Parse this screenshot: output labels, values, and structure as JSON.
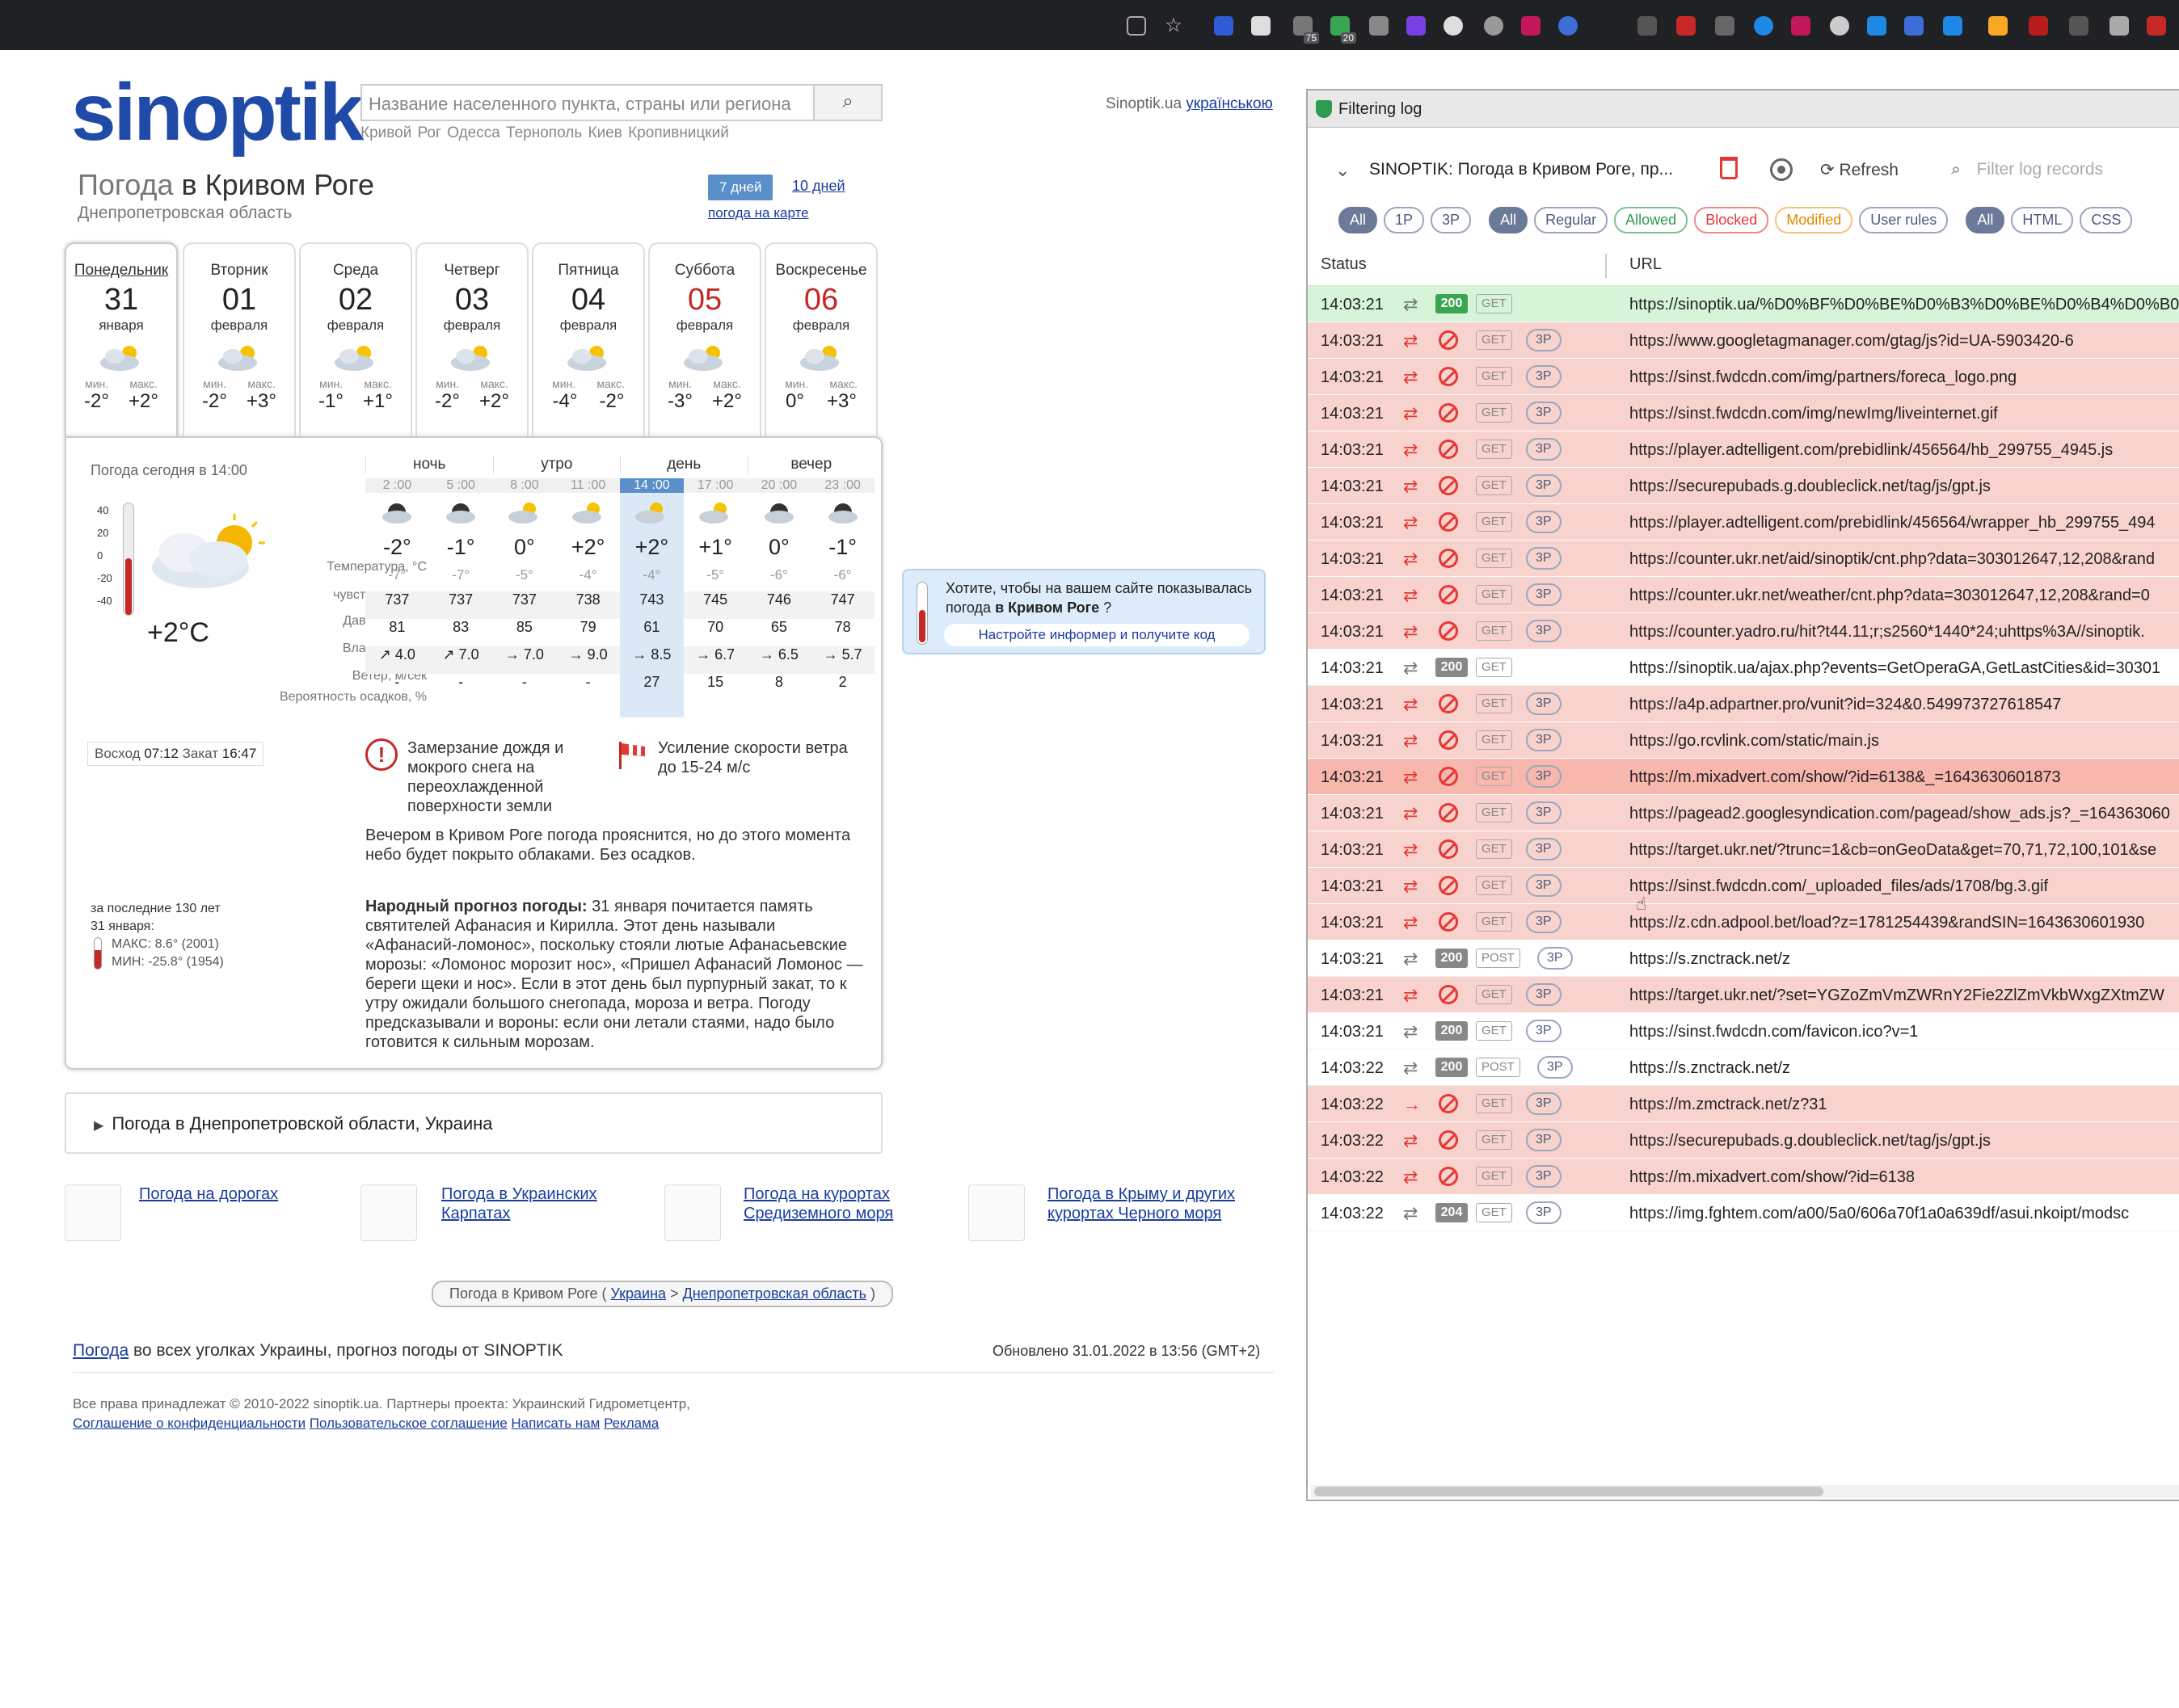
{
  "browser": {
    "extension_badges": [
      "75",
      "20"
    ]
  },
  "site": {
    "logo": "sinoptik",
    "search_placeholder": "Название населенного пункта, страны или региона",
    "quick_cities": "Кривой Рог Одесса Тернополь Киев Кропивницкий",
    "lang_prefix": "Sinoptik.ua",
    "lang_link": "українською",
    "title_prefix": "Погода",
    "title_city": "в Кривом Роге",
    "region": "Днепропетровская область",
    "btn_7": "7 дней",
    "btn_10": "10 дней",
    "map_link": "погода на карте",
    "days": [
      {
        "name": "Понедельник",
        "num": "31",
        "month": "января",
        "min": "-2°",
        "max": "+2°",
        "red": false,
        "active": true
      },
      {
        "name": "Вторник",
        "num": "01",
        "month": "февраля",
        "min": "-2°",
        "max": "+3°",
        "red": false,
        "active": false
      },
      {
        "name": "Среда",
        "num": "02",
        "month": "февраля",
        "min": "-1°",
        "max": "+1°",
        "red": false,
        "active": false
      },
      {
        "name": "Четверг",
        "num": "03",
        "month": "февраля",
        "min": "-2°",
        "max": "+2°",
        "red": false,
        "active": false
      },
      {
        "name": "Пятница",
        "num": "04",
        "month": "февраля",
        "min": "-4°",
        "max": "-2°",
        "red": false,
        "active": false
      },
      {
        "name": "Суббота",
        "num": "05",
        "month": "февраля",
        "min": "-3°",
        "max": "+2°",
        "red": true,
        "active": false
      },
      {
        "name": "Воскресенье",
        "num": "06",
        "month": "февраля",
        "min": "0°",
        "max": "+3°",
        "red": true,
        "active": false
      }
    ],
    "min_label": "мин.",
    "max_label": "макс.",
    "today_label": "Погода сегодня в 14:00",
    "scale": [
      "40",
      "20",
      "0",
      "-20",
      "-40"
    ],
    "current_temp": "+2°C",
    "sunrise_label": "Восход",
    "sunrise": "07:12",
    "sunset_label": "Закат",
    "sunset": "16:47",
    "periods": [
      "ночь",
      "утро",
      "день",
      "вечер"
    ],
    "hours": [
      "2 :00",
      "5 :00",
      "8 :00",
      "11 :00",
      "14 :00",
      "17 :00",
      "20 :00",
      "23 :00"
    ],
    "row_labels": [
      "Температура, °C",
      "чувствуется как",
      "Давление, мм",
      "Влажность, %",
      "Ветер, м/сек",
      "Вероятность осадков, %"
    ],
    "temp": [
      "-2°",
      "-1°",
      "0°",
      "+2°",
      "+2°",
      "+1°",
      "0°",
      "-1°"
    ],
    "feels": [
      "-7°",
      "-7°",
      "-5°",
      "-4°",
      "-4°",
      "-5°",
      "-6°",
      "-6°"
    ],
    "pressure": [
      "737",
      "737",
      "737",
      "738",
      "743",
      "745",
      "746",
      "747"
    ],
    "humidity": [
      "81",
      "83",
      "85",
      "79",
      "61",
      "70",
      "65",
      "78"
    ],
    "wind": [
      "↗ 4.0",
      "↗ 7.0",
      "→ 7.0",
      "→ 9.0",
      "→ 8.5",
      "→ 6.7",
      "→ 6.5",
      "→ 5.7"
    ],
    "precip": [
      "-",
      "-",
      "-",
      "-",
      "27",
      "15",
      "8",
      "2"
    ],
    "warning1": "Замерзание дождя и мокрого снега на переохлажденной поверхности земли",
    "warning2": "Усиление скорости ветра до 15-24 м/с",
    "description": "Вечером в Кривом Роге погода прояснится, но до этого момента небо будет покрыто облаками. Без осадков.",
    "folk_label": "Народный прогноз погоды:",
    "folk_text": " 31 января почитается память святителей Афанасия и Кирилла. Этот день называли «Афанасий-ломонос», поскольку стояли лютые Афанасьевские морозы: «Ломонос морозит нос», «Пришел Афанасий Ломонос — береги щеки и нос». Если в этот день был пурпурный закат, то к утру ожидали большого снегопада, мороза и ветра. Погоду предсказывали и вороны: если они летали стаями, надо было готовится к сильным морозам.",
    "history_title": "за последние 130 лет",
    "history_date": "31 января:",
    "history_max": "МАКС: 8.6° (2001)",
    "history_min": "МИН: -25.8° (1954)",
    "informer_text_1": "Хотите, чтобы на вашем сайте показывалась погода ",
    "informer_city": "в Кривом Роге",
    "informer_text_2": " ?",
    "informer_button": "Настройте информер и получите код",
    "region_block": "Погода в Днепропетровской области, Украина",
    "bottom_links": [
      "Погода на дорогах",
      "Погода в Украинских Карпатах",
      "Погода на курортах Средиземного моря",
      "Погода в Крыму и других курортах Черного моря"
    ],
    "crumb_prefix": "Погода в Кривом Роге (",
    "crumb_ua": "Украина",
    "crumb_sep": ">",
    "crumb_region": "Днепропетровская область",
    "crumb_end": ")",
    "footer_link": "Погода",
    "footer_text": " во всех уголках Украины, прогноз погоды от SINOPTIK",
    "updated": "Обновлено 31.01.2022 в 13:56 (GMT+2)",
    "copyright": "Все права принадлежат © 2010-2022 sinoptik.ua. Партнеры проекта: Украинский Гидрометцентр,",
    "footer_links": [
      "Соглашение о конфиденциальности",
      "Пользовательское соглашение",
      "Написать нам",
      "Реклама"
    ]
  },
  "log": {
    "window_title": "Filtering log",
    "tab_title": "SINOPTIK: Погода в Кривом Роге, пр...",
    "refresh": "Refresh",
    "filter_placeholder": "Filter log records",
    "chips1": [
      "All",
      "1P",
      "3P"
    ],
    "chips2": [
      "All",
      "Regular",
      "Allowed",
      "Blocked",
      "Modified",
      "User rules"
    ],
    "chips3": [
      "All",
      "HTML",
      "CSS"
    ],
    "col_status": "Status",
    "col_url": "URL",
    "rows": [
      {
        "time": "14:03:21",
        "kind": "ok",
        "code": "200",
        "method": "GET",
        "third": "",
        "url": "https://sinoptik.ua/%D0%BF%D0%BE%D0%B3%D0%BE%D0%B4%D0%B0-%D0%BA"
      },
      {
        "time": "14:03:21",
        "kind": "blk",
        "code": "",
        "method": "GET",
        "third": "3P",
        "url": "https://www.googletagmanager.com/gtag/js?id=UA-5903420-6"
      },
      {
        "time": "14:03:21",
        "kind": "blk",
        "code": "",
        "method": "GET",
        "third": "3P",
        "url": "https://sinst.fwdcdn.com/img/partners/foreca_logo.png"
      },
      {
        "time": "14:03:21",
        "kind": "blk",
        "code": "",
        "method": "GET",
        "third": "3P",
        "url": "https://sinst.fwdcdn.com/img/newImg/liveinternet.gif"
      },
      {
        "time": "14:03:21",
        "kind": "blk",
        "code": "",
        "method": "GET",
        "third": "3P",
        "url": "https://player.adtelligent.com/prebidlink/456564/hb_299755_4945.js"
      },
      {
        "time": "14:03:21",
        "kind": "blk",
        "code": "",
        "method": "GET",
        "third": "3P",
        "url": "https://securepubads.g.doubleclick.net/tag/js/gpt.js"
      },
      {
        "time": "14:03:21",
        "kind": "blk",
        "code": "",
        "method": "GET",
        "third": "3P",
        "url": "https://player.adtelligent.com/prebidlink/456564/wrapper_hb_299755_494"
      },
      {
        "time": "14:03:21",
        "kind": "blk",
        "code": "",
        "method": "GET",
        "third": "3P",
        "url": "https://counter.ukr.net/aid/sinoptik/cnt.php?data=303012647,12,208&rand"
      },
      {
        "time": "14:03:21",
        "kind": "blk",
        "code": "",
        "method": "GET",
        "third": "3P",
        "url": "https://counter.ukr.net/weather/cnt.php?data=303012647,12,208&rand=0"
      },
      {
        "time": "14:03:21",
        "kind": "blk",
        "code": "",
        "method": "GET",
        "third": "3P",
        "url": "https://counter.yadro.ru/hit?t44.11;r;s2560*1440*24;uhttps%3A//sinoptik."
      },
      {
        "time": "14:03:21",
        "kind": "plain",
        "code": "200",
        "method": "GET",
        "third": "",
        "url": "https://sinoptik.ua/ajax.php?events=GetOperaGA,GetLastCities&id=30301"
      },
      {
        "time": "14:03:21",
        "kind": "blk",
        "code": "",
        "method": "GET",
        "third": "3P",
        "url": "https://a4p.adpartner.pro/vunit?id=324&0.549973727618547"
      },
      {
        "time": "14:03:21",
        "kind": "blk",
        "code": "",
        "method": "GET",
        "third": "3P",
        "url": "https://go.rcvlink.com/static/main.js"
      },
      {
        "time": "14:03:21",
        "kind": "blk2",
        "code": "",
        "method": "GET",
        "third": "3P",
        "url": "https://m.mixadvert.com/show/?id=6138&_=1643630601873"
      },
      {
        "time": "14:03:21",
        "kind": "blk",
        "code": "",
        "method": "GET",
        "third": "3P",
        "url": "https://pagead2.googlesyndication.com/pagead/show_ads.js?_=164363060"
      },
      {
        "time": "14:03:21",
        "kind": "blk",
        "code": "",
        "method": "GET",
        "third": "3P",
        "url": "https://target.ukr.net/?trunc=1&cb=onGeoData&get=70,71,72,100,101&se"
      },
      {
        "time": "14:03:21",
        "kind": "blk",
        "code": "",
        "method": "GET",
        "third": "3P",
        "url": "https://sinst.fwdcdn.com/_uploaded_files/ads/1708/bg.3.gif"
      },
      {
        "time": "14:03:21",
        "kind": "blk",
        "code": "",
        "method": "GET",
        "third": "3P",
        "url": "https://z.cdn.adpool.bet/load?z=1781254439&randSIN=1643630601930"
      },
      {
        "time": "14:03:21",
        "kind": "plain",
        "code": "200",
        "method": "POST",
        "third": "3P",
        "url": "https://s.znctrack.net/z"
      },
      {
        "time": "14:03:21",
        "kind": "blk",
        "code": "",
        "method": "GET",
        "third": "3P",
        "url": "https://target.ukr.net/?set=YGZoZmVmZWRnY2Fie2ZlZmVkbWxgZXtmZW"
      },
      {
        "time": "14:03:21",
        "kind": "plain",
        "code": "200",
        "method": "GET",
        "third": "3P",
        "url": "https://sinst.fwdcdn.com/favicon.ico?v=1"
      },
      {
        "time": "14:03:22",
        "kind": "plain",
        "code": "200",
        "method": "POST",
        "third": "3P",
        "url": "https://s.znctrack.net/z"
      },
      {
        "time": "14:03:22",
        "kind": "blk",
        "code": "",
        "method": "GET",
        "third": "3P",
        "url": "https://m.zmctrack.net/z?31",
        "oneway": true
      },
      {
        "time": "14:03:22",
        "kind": "blk",
        "code": "",
        "method": "GET",
        "third": "3P",
        "url": "https://securepubads.g.doubleclick.net/tag/js/gpt.js"
      },
      {
        "time": "14:03:22",
        "kind": "blk",
        "code": "",
        "method": "GET",
        "third": "3P",
        "url": "https://m.mixadvert.com/show/?id=6138"
      },
      {
        "time": "14:03:22",
        "kind": "plain",
        "code": "204",
        "method": "GET",
        "third": "3P",
        "url": "https://img.fghtem.com/a00/5a0/606a70f1a0a639df/asui.nkoipt/modsc"
      }
    ]
  }
}
